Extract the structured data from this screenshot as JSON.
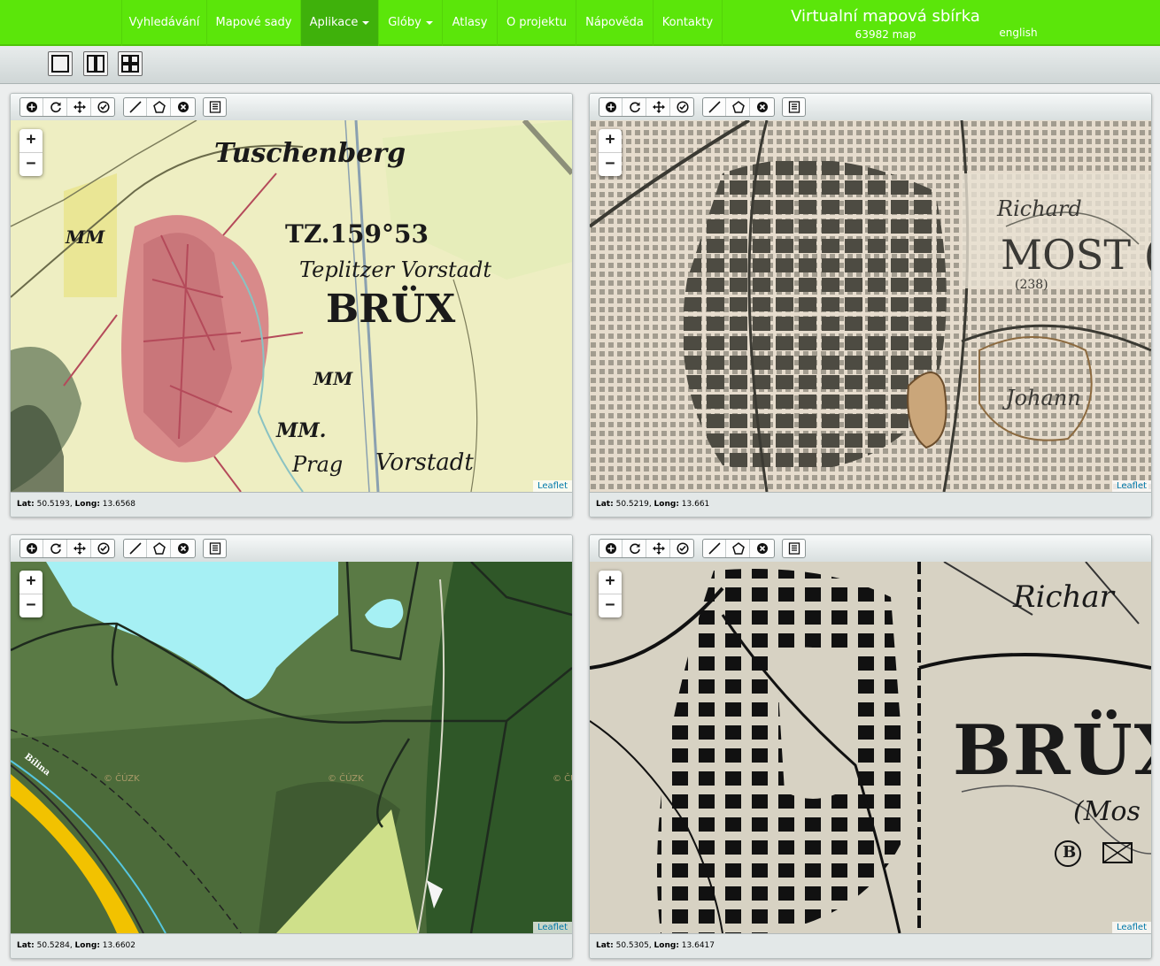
{
  "nav": {
    "items": [
      {
        "label": "Vyhledávání"
      },
      {
        "label": "Mapové sady"
      },
      {
        "label": "Aplikace",
        "active": true,
        "dropdown": true
      },
      {
        "label": "Glóby",
        "dropdown": true
      },
      {
        "label": "Atlasy"
      },
      {
        "label": "O projektu"
      },
      {
        "label": "Nápověda"
      },
      {
        "label": "Kontakty"
      }
    ],
    "brand_title": "Virtualní mapová sbírka",
    "brand_count": "63982 map",
    "language": "english",
    "colors": {
      "bar": "#5be60a",
      "active": "#3fb10b"
    }
  },
  "layout_buttons": [
    {
      "icon": "single-pane-icon"
    },
    {
      "icon": "two-pane-icon"
    },
    {
      "icon": "four-pane-icon"
    }
  ],
  "panel_toolbar": {
    "groups": [
      [
        "zoom-in-circle-icon",
        "rotate-icon",
        "pan-move-icon",
        "check-circle-icon"
      ],
      [
        "draw-line-icon",
        "draw-polygon-icon",
        "clear-circle-icon"
      ],
      [
        "list-icon"
      ]
    ]
  },
  "zoom": {
    "in": "+",
    "out": "−"
  },
  "attribution": "Leaflet",
  "coord_labels": {
    "lat": "Lat:",
    "long": "Long:"
  },
  "panels": [
    {
      "lat": "50.5193",
      "long": "13.6568",
      "labels": [
        "Tuschenberg",
        "TZ.159°53",
        "Teplitzer Vorstadt",
        "BRÜX",
        "MM",
        "MM",
        "MM.",
        "Prag",
        "Vorstadt"
      ]
    },
    {
      "lat": "50.5219",
      "long": "13.661",
      "labels": [
        "Richard",
        "MOST (B",
        "(238)",
        "Johann"
      ]
    },
    {
      "lat": "50.5284",
      "long": "13.6602",
      "labels": [
        "Bílina",
        "© ČÚZK",
        "© ČÚZK",
        "© ČÚZK"
      ]
    },
    {
      "lat": "50.5305",
      "long": "13.6417",
      "labels": [
        "Richar",
        "BRÜX",
        "(Mos",
        "B"
      ]
    }
  ]
}
